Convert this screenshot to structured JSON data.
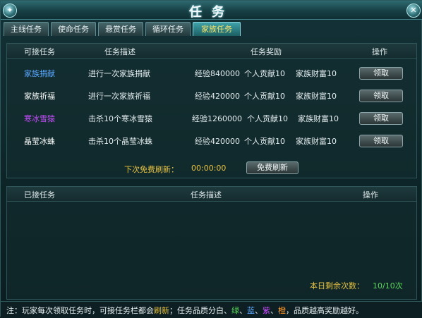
{
  "window": {
    "title": "任务"
  },
  "tabs": [
    {
      "label": "主线任务",
      "active": false
    },
    {
      "label": "使命任务",
      "active": false
    },
    {
      "label": "悬赏任务",
      "active": false
    },
    {
      "label": "循环任务",
      "active": false
    },
    {
      "label": "家族任务",
      "active": true
    }
  ],
  "available": {
    "headers": {
      "task": "可接任务",
      "desc": "任务描述",
      "reward": "任务奖励",
      "op": "操作"
    },
    "rows": [
      {
        "name": "家族捐献",
        "name_color": "#5aa7ff",
        "desc": "进行一次家族捐献",
        "exp": "经验840000",
        "personal": "个人贡献10",
        "family": "家族财富10",
        "button": "领取"
      },
      {
        "name": "家族祈福",
        "name_color": "#ffffff",
        "desc": "进行一次家族祈福",
        "exp": "经验420000",
        "personal": "个人贡献10",
        "family": "家族财富10",
        "button": "领取"
      },
      {
        "name": "寒冰雪猿",
        "name_color": "#c84cff",
        "desc": "击杀10个寒冰雪猿",
        "exp": "经验1260000",
        "personal": "个人贡献10",
        "family": "家族财富10",
        "button": "领取"
      },
      {
        "name": "晶莹冰蛛",
        "name_color": "#ffffff",
        "desc": "击杀10个晶莹冰蛛",
        "exp": "经验420000",
        "personal": "个人贡献10",
        "family": "家族财富10",
        "button": "领取"
      }
    ],
    "refresh_label": "下次免费刷新：",
    "refresh_time": "00:00:00",
    "refresh_button": "免费刷新"
  },
  "accepted": {
    "headers": {
      "task": "已接任务",
      "desc": "任务描述",
      "op": "操作"
    },
    "remaining_label": "本日剩余次数：",
    "remaining_value": "10/10次"
  },
  "note": {
    "prefix": "注：玩家每次领取任务时，可接任务栏都会",
    "refresh_word": "刷新",
    "middle": "；任务品质分白、",
    "green": "绿",
    "sep1": "、",
    "blue": "蓝",
    "sep2": "、",
    "purple": "紫",
    "sep3": "、",
    "orange": "橙",
    "suffix": "，品质越高奖励越好。"
  },
  "colors": {
    "gold": "#e7c241",
    "green": "#5bd75b",
    "blue": "#5aa7ff",
    "purple": "#c84cff",
    "orange": "#ff9a2e"
  }
}
